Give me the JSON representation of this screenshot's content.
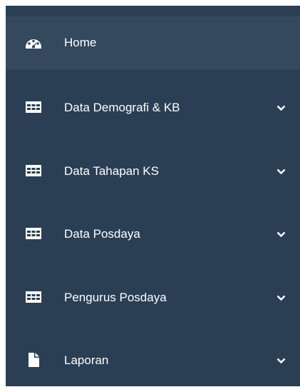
{
  "sidebar": {
    "background": "#2a3f54",
    "active_background": "#34495e",
    "text_color": "#ffffff",
    "items": [
      {
        "label": "Home",
        "icon": "dashboard-icon",
        "active": true,
        "has_submenu": false
      },
      {
        "label": "Data Demografi & KB",
        "icon": "table-icon",
        "active": false,
        "has_submenu": true
      },
      {
        "label": "Data Tahapan KS",
        "icon": "table-icon",
        "active": false,
        "has_submenu": true
      },
      {
        "label": "Data Posdaya",
        "icon": "table-icon",
        "active": false,
        "has_submenu": true
      },
      {
        "label": "Pengurus Posdaya",
        "icon": "table-icon",
        "active": false,
        "has_submenu": true
      },
      {
        "label": "Laporan",
        "icon": "file-icon",
        "active": false,
        "has_submenu": true
      }
    ]
  }
}
